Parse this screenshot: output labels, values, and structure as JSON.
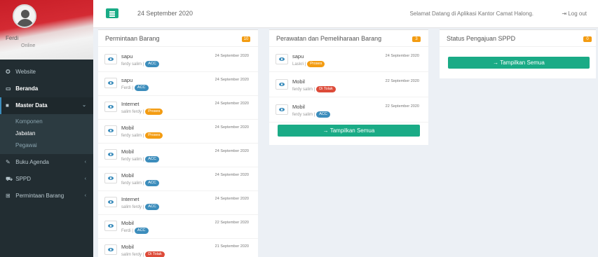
{
  "colors": {
    "sidebar": "#222d32",
    "accent": "#1aab86",
    "blue_badge": "#3c8dbc",
    "orange_badge": "#f39c12",
    "red_badge": "#dd4b39"
  },
  "sidebar": {
    "user_name": "Ferdi",
    "user_role": "Online",
    "items": [
      {
        "label": "Website",
        "icon": "globe-icon"
      },
      {
        "label": "Beranda",
        "icon": "monitor-icon"
      },
      {
        "label": "Master Data",
        "icon": "database-icon",
        "sub": [
          "Komponen",
          "Jabatan",
          "Pegawai"
        ]
      },
      {
        "label": "Buku Agenda",
        "icon": "book-icon"
      },
      {
        "label": "SPPD",
        "icon": "car-icon"
      },
      {
        "label": "Permintaan Barang",
        "icon": "box-icon"
      }
    ]
  },
  "topbar": {
    "date": "24 September 2020",
    "welcome": "Selamat Datang di Aplikasi Kantor Camat Halong.",
    "logout": "Log out"
  },
  "panels": {
    "permintaan": {
      "title": "Permintaan Barang",
      "badge": "10",
      "rows": [
        {
          "title": "sapu",
          "sub": "ferdy salim |",
          "tag": "ACC",
          "tag_color": "blue",
          "date": "24 September 2020"
        },
        {
          "title": "sapu",
          "sub": "Ferdi |",
          "tag": "ACC",
          "tag_color": "blue",
          "date": "24 September 2020"
        },
        {
          "title": "Internet",
          "sub": "salim ferdy |",
          "tag": "Proses",
          "tag_color": "orange",
          "date": "24 September 2020"
        },
        {
          "title": "Mobil",
          "sub": "ferdy salim |",
          "tag": "Proses",
          "tag_color": "orange",
          "date": "24 September 2020"
        },
        {
          "title": "Mobil",
          "sub": "ferdy salim |",
          "tag": "ACC",
          "tag_color": "blue",
          "date": "24 September 2020"
        },
        {
          "title": "Mobil",
          "sub": "ferdy salim |",
          "tag": "ACC",
          "tag_color": "blue",
          "date": "24 September 2020"
        },
        {
          "title": "Internet",
          "sub": "salim ferdy |",
          "tag": "ACC",
          "tag_color": "blue",
          "date": "24 September 2020"
        },
        {
          "title": "Mobil",
          "sub": "Ferdi |",
          "tag": "ACC",
          "tag_color": "blue",
          "date": "22 September 2020"
        },
        {
          "title": "Mobil",
          "sub": "salim ferdy |",
          "tag": "Di Tolak",
          "tag_color": "red",
          "date": "21 September 2020"
        }
      ]
    },
    "perawatan": {
      "title": "Perawatan dan Pemeliharaan Barang",
      "badge": "3",
      "rows": [
        {
          "title": "sapu",
          "sub": "Laskri |",
          "tag": "Proses",
          "tag_color": "orange",
          "date": "24 September 2020"
        },
        {
          "title": "Mobil",
          "sub": "ferdy salim |",
          "tag": "Di Tolak",
          "tag_color": "red",
          "date": "22 September 2020"
        },
        {
          "title": "Mobil",
          "sub": "ferdy salim |",
          "tag": "ACC",
          "tag_color": "blue",
          "date": "22 September 2020"
        }
      ],
      "button": "→ Tampilkan Semua"
    },
    "sppd": {
      "title": "Status Pengajuan SPPD",
      "badge": "0",
      "button": "→ Tampilkan Semua"
    }
  }
}
